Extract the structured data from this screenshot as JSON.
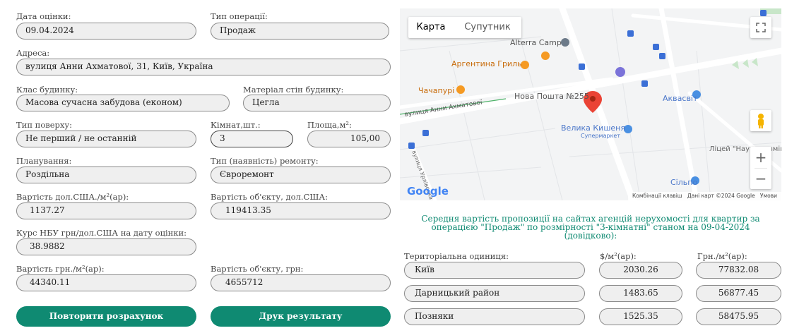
{
  "form": {
    "date_label": "Дата оцінки:",
    "date_value": "09.04.2024",
    "operation_label": "Тип операції:",
    "operation_value": "Продаж",
    "address_label": "Адреса:",
    "address_value": "вулиця Анни Ахматової, 31, Київ, Україна",
    "class_label": "Клас будинку:",
    "class_value": "Масова сучасна забудова (економ)",
    "wall_label": "Матеріал стін будинку:",
    "wall_value": "Цегла",
    "floor_label": "Тип поверху:",
    "floor_value": "Не перший / не останній",
    "rooms_label": "Кімнат,шт.:",
    "rooms_value": "3",
    "area_label": "Площа,м²:",
    "area_value": "105,00",
    "layout_label": "Планування:",
    "layout_value": "Роздільна",
    "repair_label": "Тип (наявність) ремонту:",
    "repair_value": "Євроремонт",
    "usd_m2_label": "Вартість дол.США./м²(ар):",
    "usd_m2_value": "1137.27",
    "usd_total_label": "Вартість об'єкту, дол.США:",
    "usd_total_value": "119413.35",
    "rate_label": "Курс НБУ грн/дол.США на дату оцінки:",
    "rate_value": "38.9882",
    "uah_m2_label": "Вартість грн./м²(ар):",
    "uah_m2_value": "44340.11",
    "uah_total_label": "Вартість об'єкту, грн:",
    "uah_total_value": "4655712"
  },
  "buttons": {
    "recalc": "Повторити розрахунок",
    "print": "Друк результату"
  },
  "map": {
    "tab_map": "Карта",
    "tab_satellite": "Супутник",
    "places": {
      "alterra": "Alterra Camp",
      "argentina": "Аргентина Гриль",
      "chachapuri": "Чачапурі",
      "novaposhta": "Нова Пошта №255",
      "aquasvit": "Аквасвіт",
      "street": "вулиця Анни Ахматової",
      "velyka_kyshenya": "Велика Кишеня",
      "supermarket": "Супермаркет",
      "litsey": "Ліцей \"Наукова змін",
      "urlivska": "вулиця Урлівська",
      "silpo": "Сільпо"
    },
    "footer": {
      "keys": "Комбінації клавіш",
      "data": "Дані карт ©2024 Google",
      "terms": "Умови"
    },
    "google": "Google",
    "zoom_in": "+",
    "zoom_out": "−"
  },
  "info_text": {
    "line1": "Середня вартість пропозиції на сайтах агенцій нерухомості для квартир за",
    "line2": "операцією \"Продаж\" по розмірності \"3-кімнатні\" станом на 09-04-2024",
    "line3": "(довідково):"
  },
  "table": {
    "headers": {
      "territory": "Територіальна одиниця:",
      "usd": "$/м²(ар):",
      "uah": "Грн./м²(ар):"
    },
    "rows": [
      {
        "name": "Київ",
        "usd": "2030.26",
        "uah": "77832.08"
      },
      {
        "name": "Дарницький район",
        "usd": "1483.65",
        "uah": "56877.45"
      },
      {
        "name": "Позняки",
        "usd": "1525.35",
        "uah": "58475.95"
      }
    ]
  },
  "colors": {
    "accent": "#0f8a72",
    "field_bg": "#efefef",
    "field_border": "#8a8a8a"
  }
}
